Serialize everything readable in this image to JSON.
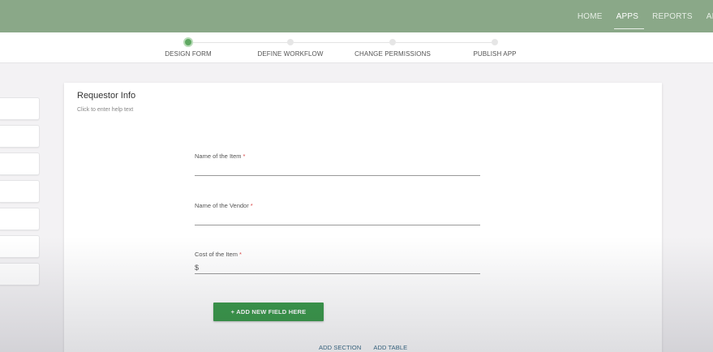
{
  "topnav": {
    "items": [
      {
        "label": "HOME"
      },
      {
        "label": "APPS",
        "active": true
      },
      {
        "label": "REPORTS"
      },
      {
        "label": "AD"
      }
    ]
  },
  "steps": [
    {
      "label": "DESIGN FORM",
      "active": true
    },
    {
      "label": "DEFINE WORKFLOW"
    },
    {
      "label": "CHANGE PERMISSIONS"
    },
    {
      "label": "PUBLISH APP"
    }
  ],
  "section": {
    "title": "Requestor Info",
    "help": "Click to enter help text"
  },
  "fields": [
    {
      "label": "Name of the Item",
      "required": "*",
      "value": ""
    },
    {
      "label": "Name of the Vendor",
      "required": "*",
      "value": ""
    },
    {
      "label": "Cost of the Item",
      "required": "*",
      "value": "$"
    }
  ],
  "buttons": {
    "add_field": "+ ADD NEW FIELD HERE",
    "add_section": "ADD SECTION",
    "add_table": "ADD TABLE"
  },
  "colors": {
    "topbar": "#8aa888",
    "primary_button": "#3c9a4c",
    "active_step": "#5fa862",
    "required": "#d94545",
    "link": "#3a6c88"
  }
}
